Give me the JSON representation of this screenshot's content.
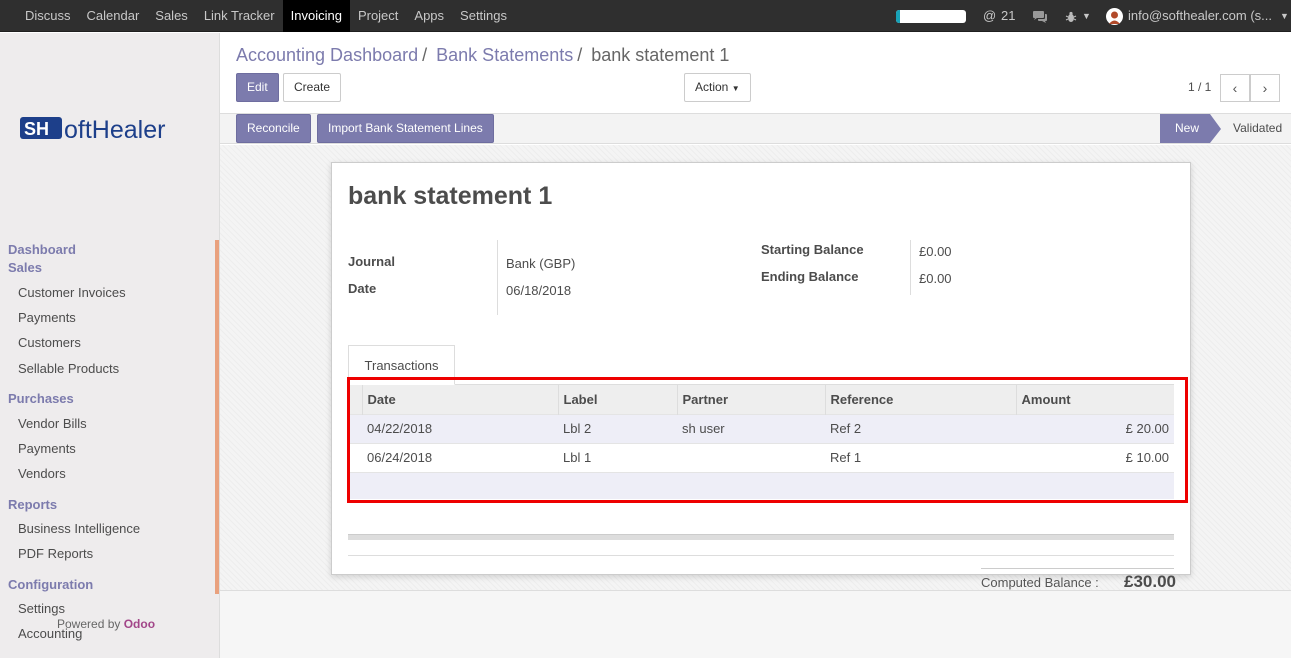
{
  "topbar": {
    "menu": [
      "Discuss",
      "Calendar",
      "Sales",
      "Link Tracker",
      "Invoicing",
      "Project",
      "Apps",
      "Settings"
    ],
    "active_menu": "Invoicing",
    "progress_fraction": 0.06,
    "mentions_count": "21",
    "user": "info@softhealer.com (s..."
  },
  "sidebar": {
    "logo": "SoftHealer",
    "sections": {
      "dashboard": "Dashboard",
      "sales": "Sales",
      "purchases": "Purchases",
      "reports": "Reports",
      "configuration": "Configuration"
    },
    "sales_items": [
      "Customer Invoices",
      "Payments",
      "Customers",
      "Sellable Products"
    ],
    "purchase_items": [
      "Vendor Bills",
      "Payments",
      "Vendors"
    ],
    "report_items": [
      "Business Intelligence",
      "PDF Reports"
    ],
    "config_items": [
      "Settings",
      "Accounting"
    ],
    "powered_by": "Powered by",
    "powered_brand": "Odoo"
  },
  "breadcrumb": {
    "level1": "Accounting Dashboard",
    "level2": "Bank Statements",
    "current": "bank statement 1",
    "sep": "/"
  },
  "buttons": {
    "edit": "Edit",
    "create": "Create",
    "action": "Action",
    "reconcile": "Reconcile",
    "import_lines": "Import Bank Statement Lines"
  },
  "pager": {
    "value": "1 / 1"
  },
  "status": {
    "new": "New",
    "validated": "Validated"
  },
  "form": {
    "title": "bank statement 1",
    "journal_label": "Journal",
    "journal_value": "Bank (GBP)",
    "date_label": "Date",
    "date_value": "06/18/2018",
    "starting_label": "Starting Balance",
    "starting_value": "£0.00",
    "ending_label": "Ending Balance",
    "ending_value": "£0.00",
    "tab": "Transactions",
    "columns": [
      "Date",
      "Label",
      "Partner",
      "Reference",
      "Amount"
    ],
    "rows": [
      {
        "date": "04/22/2018",
        "label": "Lbl 2",
        "partner": "sh user",
        "ref": "Ref 2",
        "amount": "£ 20.00"
      },
      {
        "date": "06/24/2018",
        "label": "Lbl 1",
        "partner": "",
        "ref": "Ref 1",
        "amount": "£ 10.00"
      }
    ],
    "computed_label": "Computed Balance :",
    "computed_value": "£30.00"
  },
  "colors": {
    "primary": "#7c7bad",
    "highlight": "#ee0000",
    "topbar": "#2f2f2f"
  }
}
